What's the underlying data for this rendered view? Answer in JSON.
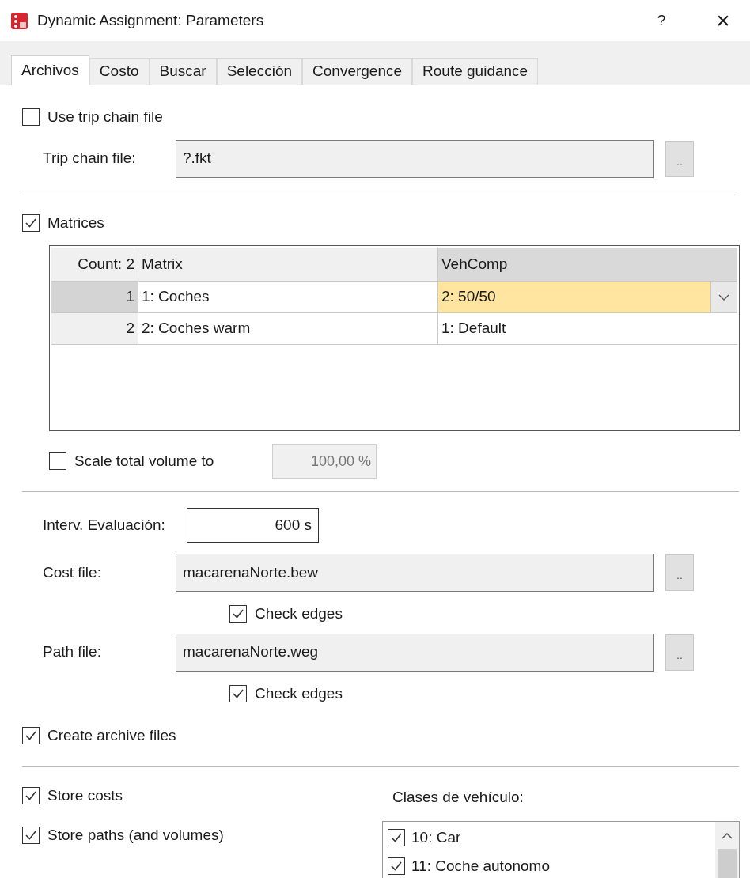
{
  "window": {
    "title": "Dynamic Assignment: Parameters",
    "help": "?",
    "close": "×"
  },
  "tabs": [
    {
      "label": "Archivos",
      "selected": true
    },
    {
      "label": "Costo",
      "selected": false
    },
    {
      "label": "Buscar",
      "selected": false
    },
    {
      "label": "Selección",
      "selected": false
    },
    {
      "label": "Convergence",
      "selected": false
    },
    {
      "label": "Route guidance",
      "selected": false
    }
  ],
  "trip_chain": {
    "label": "Use trip chain file",
    "checked": false,
    "file_label": "Trip chain file:",
    "file_value": "?.fkt",
    "browse": ".."
  },
  "matrices": {
    "label": "Matrices",
    "checked": true,
    "columns": [
      {
        "label": "Count: 2",
        "selected": false
      },
      {
        "label": "Matrix",
        "selected": false
      },
      {
        "label": "VehComp",
        "selected": true
      }
    ],
    "rows": [
      {
        "index": "1",
        "matrix": "1: Coches",
        "vehcomp": "2: 50/50",
        "selected": true
      },
      {
        "index": "2",
        "matrix": "2: Coches warm",
        "vehcomp": "1: Default",
        "selected": false
      }
    ]
  },
  "scale": {
    "label": "Scale total volume to",
    "checked": false,
    "value": "100,00 %",
    "disabled": true
  },
  "interval": {
    "label": "Interv. Evaluación:",
    "value": "600 s"
  },
  "cost_file": {
    "label": "Cost file:",
    "value": "macarenaNorte.bew",
    "browse": "..",
    "check_label": "Check edges",
    "checked": true
  },
  "path_file": {
    "label": "Path file:",
    "value": "macarenaNorte.weg",
    "browse": "..",
    "check_label": "Check edges",
    "checked": true
  },
  "create_archive": {
    "label": "Create archive files",
    "checked": true
  },
  "store_costs": {
    "label": "Store costs",
    "checked": true
  },
  "store_paths": {
    "label": "Store paths (and volumes)",
    "checked": true
  },
  "vehicle_classes": {
    "label": "Clases de vehículo:",
    "items": [
      {
        "label": "10: Car",
        "checked": true
      },
      {
        "label": "11: Coche autonomo",
        "checked": true
      }
    ]
  }
}
